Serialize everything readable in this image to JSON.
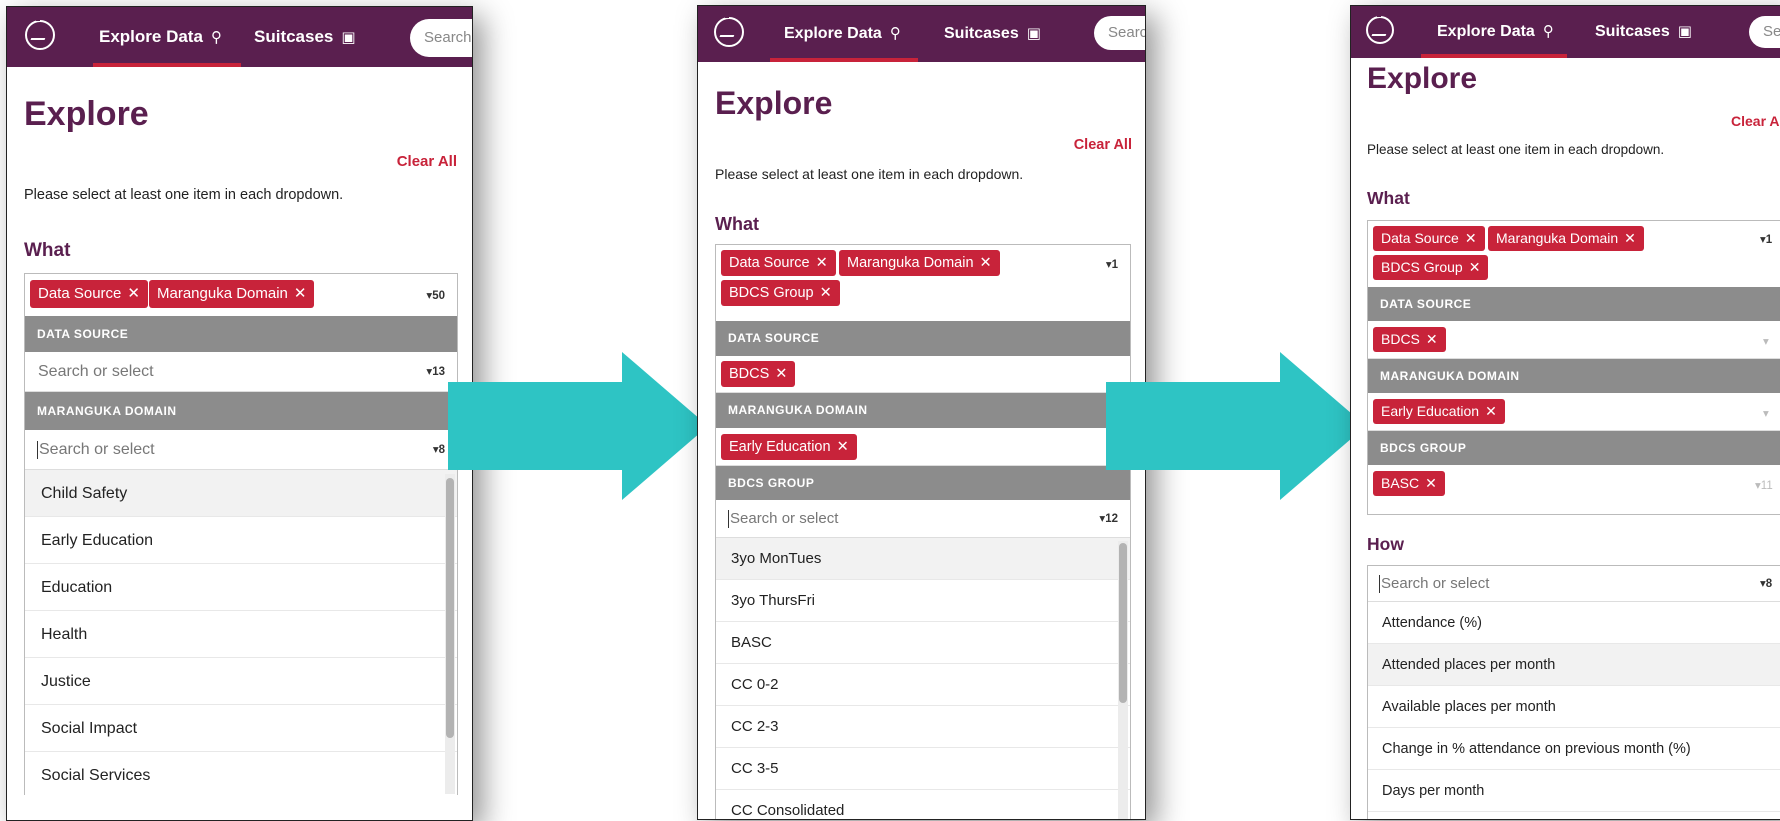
{
  "nav": {
    "explore_label": "Explore Data",
    "suitcases_label": "Suitcases",
    "search_placeholder": "Search"
  },
  "page": {
    "title": "Explore",
    "clear_all": "Clear All",
    "instruction": "Please select at least one item in each dropdown.",
    "what_label": "What",
    "how_label": "How",
    "search_or_select": "Search or select"
  },
  "tags": {
    "data_source": "Data Source",
    "maranguka_domain": "Maranguka Domain",
    "bdcs_group": "BDCS Group",
    "bdcs": "BDCS",
    "early_education": "Early Education",
    "basc": "BASC"
  },
  "groups": {
    "data_source": "DATA SOURCE",
    "maranguka_domain": "MARANGUKA DOMAIN",
    "bdcs_group": "BDCS GROUP"
  },
  "step1": {
    "what_count": "50",
    "data_source_count": "13",
    "domain_count": "8",
    "options": [
      "Child Safety",
      "Early Education",
      "Education",
      "Health",
      "Justice",
      "Social Impact",
      "Social Services"
    ]
  },
  "step2": {
    "what_count": "1",
    "bdcs_group_count": "12",
    "options": [
      "3yo MonTues",
      "3yo ThursFri",
      "BASC",
      "CC 0-2",
      "CC 2-3",
      "CC 3-5",
      "CC Consolidated"
    ]
  },
  "step3": {
    "what_count": "1",
    "bdcs_group_count": "11",
    "how_count": "8",
    "options": [
      "Attendance (%)",
      "Attended places per month",
      "Available places per month",
      "Change in % attendance on previous month (%)",
      "Days per month"
    ]
  },
  "colors": {
    "brand": "#5a1f4f",
    "tag": "#c8233a",
    "arrow": "#2ec4c4",
    "group_header": "#8c8c8c"
  }
}
